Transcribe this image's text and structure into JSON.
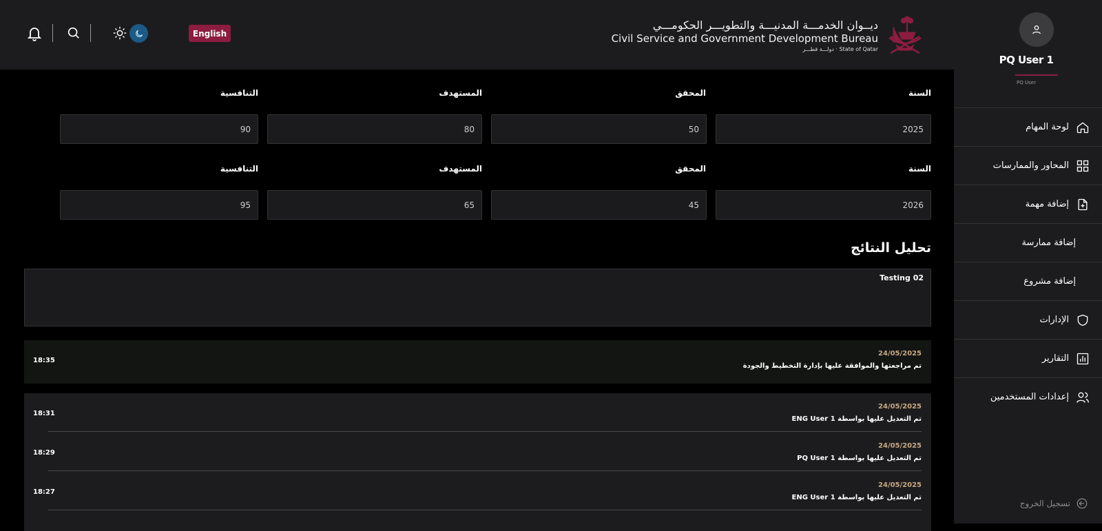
{
  "header": {
    "language_button": "English",
    "brand_arabic": "ديــوان الخدمـــة المدنيـــة والتطويـــر الحكومـــي",
    "brand_english": "Civil Service and Government Development Bureau",
    "brand_state": "State of Qatar · دولـــة قطـــر",
    "colors": {
      "accent": "#8c1d40",
      "dark_mode_toggle": "#1d5a86"
    }
  },
  "sidebar": {
    "user_name": "PQ User 1",
    "user_role": "PQ User",
    "items": [
      {
        "label": "لوحة المهام",
        "icon": "home-icon"
      },
      {
        "label": "المحاور والممارسات",
        "icon": "grid-icon"
      },
      {
        "label": "إضافة مهمة",
        "icon": "file-plus-icon"
      },
      {
        "label": "إضافة ممارسة",
        "icon": ""
      },
      {
        "label": "إضافة مشروع",
        "icon": ""
      },
      {
        "label": "الإدارات",
        "icon": "shield-icon"
      },
      {
        "label": "التقارير",
        "icon": "bar-chart-icon"
      },
      {
        "label": "إعدادات المستخدمين",
        "icon": "users-icon"
      }
    ],
    "logout": "تسجيل الخروج"
  },
  "form": {
    "labels": {
      "year": "السنة",
      "achieved": "المحقق",
      "target": "المستهدف",
      "competitive": "التنافسية"
    },
    "rows": [
      {
        "year": "2025",
        "achieved": "50",
        "target": "80",
        "competitive": "90"
      },
      {
        "year": "2026",
        "achieved": "45",
        "target": "65",
        "competitive": "95"
      }
    ]
  },
  "analysis": {
    "title": "تحليل النتائج",
    "notes": "Testing 02"
  },
  "history": [
    {
      "date": "24/05/2025",
      "text": "تم مراجعتها والموافقة عليها بإدارة التخطيط والجودة",
      "time": "18:35"
    },
    {
      "date": "24/05/2025",
      "text": "تم التعديل عليها بواسطة ENG User 1",
      "time": "18:31"
    },
    {
      "date": "24/05/2025",
      "text": "تم التعديل عليها بواسطة PQ User 1",
      "time": "18:29"
    },
    {
      "date": "24/05/2025",
      "text": "تم التعديل عليها بواسطة ENG User 1",
      "time": "18:27"
    }
  ]
}
